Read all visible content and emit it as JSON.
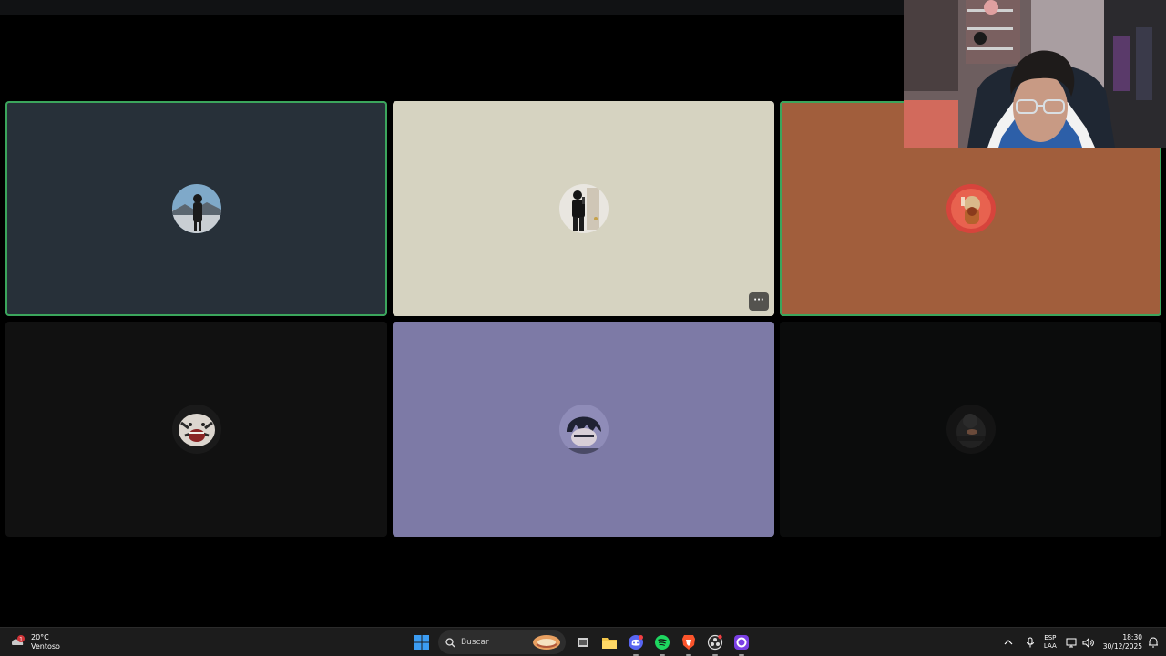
{
  "weather": {
    "temperature": "20°C",
    "condition": "Ventoso",
    "alert_count": "1"
  },
  "taskbar": {
    "search_placeholder": "Buscar",
    "pinned_apps": [
      "start-icon",
      "search-icon",
      "widget-icon",
      "task-view-icon",
      "file-explorer-icon",
      "discord-icon",
      "spotify-icon",
      "brave-icon",
      "obs-icon",
      "cortana-icon"
    ]
  },
  "tray": {
    "language_line1": "ESP",
    "language_line2": "LAA",
    "time": "18:30",
    "date": "30/12/2025"
  },
  "call": {
    "participants": [
      {
        "tile": "participant-1",
        "bg": "#273039",
        "speaking": true
      },
      {
        "tile": "participant-2",
        "bg": "#d6d3c1",
        "speaking": false
      },
      {
        "tile": "participant-3",
        "bg": "#a15e3c",
        "speaking": true
      },
      {
        "tile": "participant-4",
        "bg": "#111111",
        "speaking": false
      },
      {
        "tile": "participant-5",
        "bg": "#7d7aa6",
        "speaking": false
      },
      {
        "tile": "participant-6",
        "bg": "#0b0c0c",
        "speaking": false
      }
    ],
    "more_label": "···",
    "speaking_color": "#3ba55c"
  }
}
